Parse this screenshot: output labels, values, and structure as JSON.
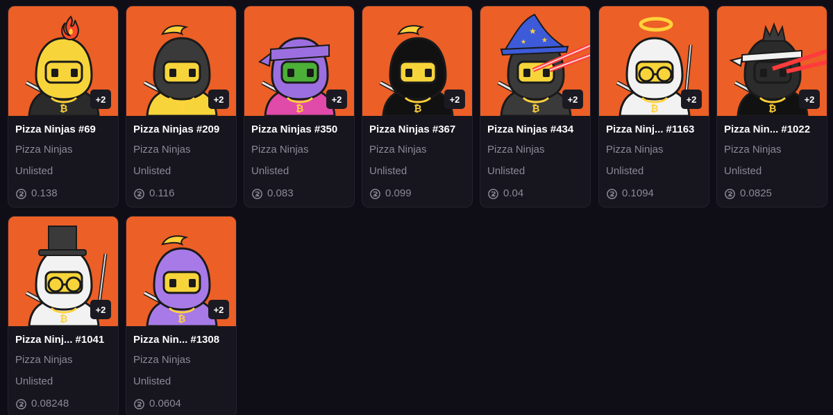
{
  "colors": {
    "art_bg": "#ec5f26",
    "page_bg": "#0f0e16",
    "card_bg": "#17161f",
    "muted_text": "#8b8a95"
  },
  "cards": [
    {
      "title": "Pizza Ninjas #69",
      "title_short": "",
      "number": "",
      "collection": "Pizza Ninjas",
      "status": "Unlisted",
      "price": "0.138",
      "badge": "+2",
      "skin": "#f7d53a",
      "hood": "#f7d53a",
      "body": "#2b2b2b",
      "accessory": "fire"
    },
    {
      "title": "Pizza Ninjas #209",
      "title_short": "",
      "number": "",
      "collection": "Pizza Ninjas",
      "status": "Unlisted",
      "price": "0.116",
      "badge": "+2",
      "skin": "#f7d53a",
      "hood": "#3a3a3a",
      "body": "#f7d53a",
      "accessory": "banana"
    },
    {
      "title": "Pizza Ninjas #350",
      "title_short": "",
      "number": "",
      "collection": "Pizza Ninjas",
      "status": "Unlisted",
      "price": "0.083",
      "badge": "+2",
      "skin": "#4caf38",
      "hood": "#9b6fe0",
      "body": "#e04aa8",
      "accessory": "bandana"
    },
    {
      "title": "Pizza Ninjas #367",
      "title_short": "",
      "number": "",
      "collection": "Pizza Ninjas",
      "status": "Unlisted",
      "price": "0.099",
      "badge": "+2",
      "skin": "#f7d53a",
      "hood": "#111111",
      "body": "#111111",
      "accessory": "banana"
    },
    {
      "title": "Pizza Ninjas #434",
      "title_short": "",
      "number": "",
      "collection": "Pizza Ninjas",
      "status": "Unlisted",
      "price": "0.04",
      "badge": "+2",
      "skin": "#f7d53a",
      "hood": "#3a3a3a",
      "body": "#3a3a3a",
      "accessory": "wizard"
    },
    {
      "title": "",
      "title_short": "Pizza Ninj...",
      "number": "#1163",
      "collection": "Pizza Ninjas",
      "status": "Unlisted",
      "price": "0.1094",
      "badge": "+2",
      "skin": "#f7d53a",
      "hood": "#f2f2f2",
      "body": "#f2f2f2",
      "accessory": "halo"
    },
    {
      "title": "",
      "title_short": "Pizza Nin...",
      "number": "#1022",
      "collection": "Pizza Ninjas",
      "status": "Unlisted",
      "price": "0.0825",
      "badge": "+2",
      "skin": "#2b2b2b",
      "hood": "#2b2b2b",
      "body": "#111111",
      "accessory": "crown"
    },
    {
      "title": "",
      "title_short": "Pizza Ninj...",
      "number": "#1041",
      "collection": "Pizza Ninjas",
      "status": "Unlisted",
      "price": "0.08248",
      "badge": "+2",
      "skin": "#f7d53a",
      "hood": "#f2f2f2",
      "body": "#f2f2f2",
      "accessory": "tophat"
    },
    {
      "title": "",
      "title_short": "Pizza Nin...",
      "number": "#1308",
      "collection": "Pizza Ninjas",
      "status": "Unlisted",
      "price": "0.0604",
      "badge": "+2",
      "skin": "#f7d53a",
      "hood": "#a77ae8",
      "body": "#a77ae8",
      "accessory": "banana"
    }
  ]
}
